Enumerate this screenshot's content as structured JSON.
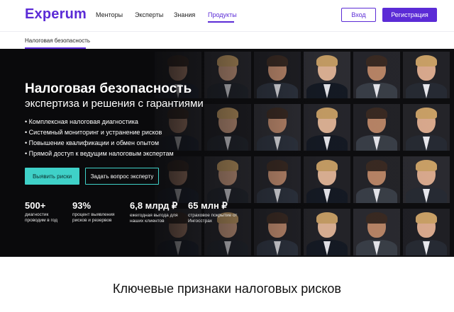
{
  "header": {
    "logo": "Experum",
    "nav": [
      {
        "label": "Менторы"
      },
      {
        "label": "Эксперты"
      },
      {
        "label": "Знания"
      },
      {
        "label": "Продукты",
        "active": true
      }
    ],
    "login_label": "Вход",
    "register_label": "Регистрация"
  },
  "subnav": {
    "label": "Налоговая безопасность"
  },
  "hero": {
    "title": "Налоговая безопасность",
    "subtitle": "экспертиза и решения с гарантиями",
    "bullets": [
      "Комплексная налоговая диагностика",
      "Системный мониторинг и устранение рисков",
      "Повышение квалификации и обмен опытом",
      "Прямой доступ к ведущим налоговым экспертам"
    ],
    "primary_button": "Выявить риски",
    "secondary_button": "Задать вопрос эксперту",
    "stats": [
      {
        "value": "500+",
        "label": "диагностик проводим в год"
      },
      {
        "value": "93%",
        "label": "процент выявления рисков и резервов"
      },
      {
        "value": "6,8 млрд ₽",
        "label": "ежегодная выгода для наших клиентов"
      },
      {
        "value": "65 млн ₽",
        "label": "страховое покрытие от Ингосстрах"
      }
    ]
  },
  "section": {
    "title": "Ключевые признаки налоговых рисков"
  },
  "colors": {
    "brand": "#5b2bd6",
    "accent": "#3fd1c8",
    "hero_bg": "#0d0d0f"
  }
}
